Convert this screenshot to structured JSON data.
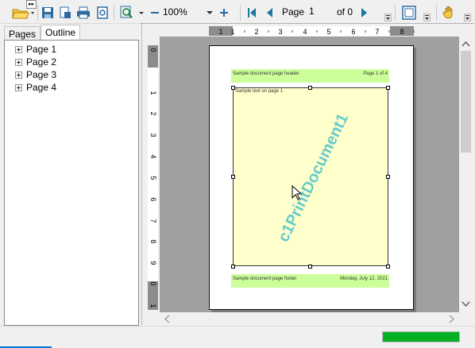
{
  "toolbar": {
    "zoom_value": "100%",
    "page_label": "Page",
    "page_value": "1",
    "page_of": "of 0",
    "overflow_glyph": "▸▸",
    "icons": [
      "open-folder-icon",
      "save-icon",
      "page-setup-icon",
      "print-icon",
      "export-icon",
      "zoom-tool-icon",
      "zoom-out-icon",
      "zoom-in-icon",
      "first-page-icon",
      "prev-page-icon",
      "next-page-icon",
      "single-page-view-icon",
      "hand-tool-icon"
    ]
  },
  "left_panel": {
    "tabs": [
      {
        "label": "Pages",
        "active": false
      },
      {
        "label": "Outline",
        "active": true
      }
    ],
    "outline_items": [
      {
        "label": "Page 1"
      },
      {
        "label": "Page 2"
      },
      {
        "label": "Page 3"
      },
      {
        "label": "Page 4"
      }
    ]
  },
  "ruler": {
    "h_ticks": [
      "1",
      "1",
      "2",
      "3",
      "4",
      "5",
      "6",
      "7",
      "8"
    ],
    "v_ticks": [
      "0",
      "1",
      "2",
      "3",
      "4",
      "5",
      "6",
      "7",
      "8",
      "9",
      "0",
      "1"
    ]
  },
  "document_page": {
    "header_left": "Sample document page header",
    "header_right": "Page 1 of 4",
    "body_text": "Sample text on page 1",
    "watermark": "c1PrintDocument1",
    "footer_left": "Sample document page footer",
    "footer_right": "Monday, July 12, 2021"
  },
  "status": {
    "progress": 1.0
  },
  "colors": {
    "band": "#ccff99",
    "body_fill": "#ffffcc",
    "watermark": "#66cccc",
    "nav_arrow": "#1a7a9c",
    "progress": "#06b025",
    "canvas": "#a0a0a0"
  }
}
